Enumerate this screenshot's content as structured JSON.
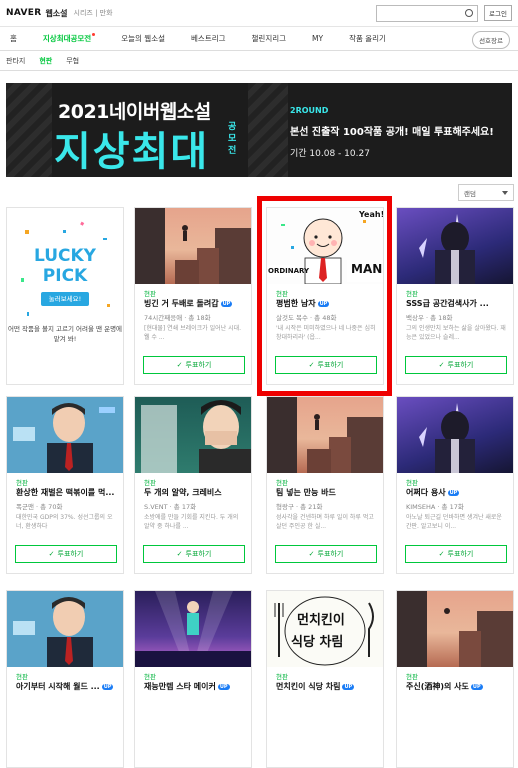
{
  "header": {
    "brand": "NAVER",
    "service": "웹소설",
    "links": "시리즈 | 만화",
    "login": "로그인"
  },
  "nav": {
    "items": [
      "홈",
      "지상최대공모전",
      "오늘의 웹소설",
      "베스트리그",
      "챌린지리그",
      "MY",
      "작품 올리기"
    ],
    "active_index": 1,
    "preference": "선호장르"
  },
  "subnav": {
    "items": [
      "판타지",
      "현판",
      "무협"
    ],
    "active_index": 1
  },
  "banner": {
    "title": "2021네이버웹소설",
    "big": "지상최대",
    "side": "공모전",
    "round": "2ROUND",
    "desc": "본선 진출작 100작품 공개! 매일 투표해주세요!",
    "date": "기간 10.08 - 10.27"
  },
  "sort": {
    "selected": "랜덤"
  },
  "lucky": {
    "line1": "LUCKY",
    "line2": "PICK",
    "button": "눌러보세요!",
    "text": "어떤 작품을 볼지 고르기 어려울 땐 운명에 맡겨 봐!"
  },
  "cards": [
    {
      "tag": "현판",
      "title": "빙긴 거 두배로 돌려갑",
      "up": true,
      "meta": "74시간째응애  ·  총 18화",
      "desc": "[현대물] 연쇄 브레이크가 일어난 시대. 웰 수 ...",
      "vote": "투표하기"
    },
    {
      "tag": "현판",
      "title": "평범한 남자",
      "up": true,
      "meta": "살것도 복수  ·  총 48화",
      "desc": "'내 시작은 미미하였으나 네 나중은 심히 창대하리라' (읍...",
      "vote": "투표하기"
    },
    {
      "tag": "현판",
      "title": "SSS급 공간검색사가 ...",
      "up": false,
      "meta": "백상우  ·  총 18화",
      "desc": "그의 인생만치 보하는 삶을 살아왔다. 재능은 있었으나 슬레...",
      "vote": "투표하기"
    },
    {
      "tag": "현판",
      "title": "환상한 재벌은 떡볶이를 먹...",
      "up": false,
      "meta": "폭군맨  ·  총 70화",
      "desc": "대한민국 GDP의 37%. 성선그룹의 오너, 환생하다",
      "vote": "투표하기"
    },
    {
      "tag": "현판",
      "title": "두 개의 알약, 크레비스",
      "up": false,
      "meta": "S.VENT  ·  총 17화",
      "desc": "소방에를 만들 기회를 지킨다. 두 개의 알약 중 하나를 ...",
      "vote": "투표하기"
    },
    {
      "tag": "현판",
      "title": "팀 넣는 만능 바드",
      "up": false,
      "meta": "형랑구  ·  총 21화",
      "desc": "성사각을 건넨하며 하루 일이 하루 먹고 살던 주인공 한 실...",
      "vote": "투표하기"
    },
    {
      "tag": "현판",
      "title": "어쩌다 용사",
      "up": true,
      "meta": "KIMSEHA  ·  총 17화",
      "desc": "아노날 퇴근길 던바하면 생겨난 새로운 간판. 알고보니 이...",
      "vote": "투표하기"
    },
    {
      "tag": "현판",
      "title": "아기부터 시작해 월드 ...",
      "up": true,
      "meta": "",
      "desc": "",
      "vote": "투표하기"
    },
    {
      "tag": "현판",
      "title": "재능만렙 스타 메이커",
      "up": true,
      "meta": "",
      "desc": "",
      "vote": "투표하기"
    },
    {
      "tag": "현판",
      "title": "먼치킨이 식당 차림",
      "up": true,
      "meta": "",
      "desc": "",
      "vote": "투표하기"
    },
    {
      "tag": "현판",
      "title": "주신(酒神)의 사도",
      "up": true,
      "meta": "",
      "desc": "",
      "vote": "투표하기"
    }
  ],
  "thumbs": {
    "ordinary": "ORDINARY",
    "man": "MAN",
    "yeah": "Yeah!",
    "restaurant_1": "먼치킨이",
    "restaurant_2": "식당 차림"
  },
  "colors": {
    "accent": "#00c73c",
    "highlight": "#ee0000",
    "banner_cyan": "#3ae7ea",
    "lucky_blue": "#28a7e1"
  }
}
